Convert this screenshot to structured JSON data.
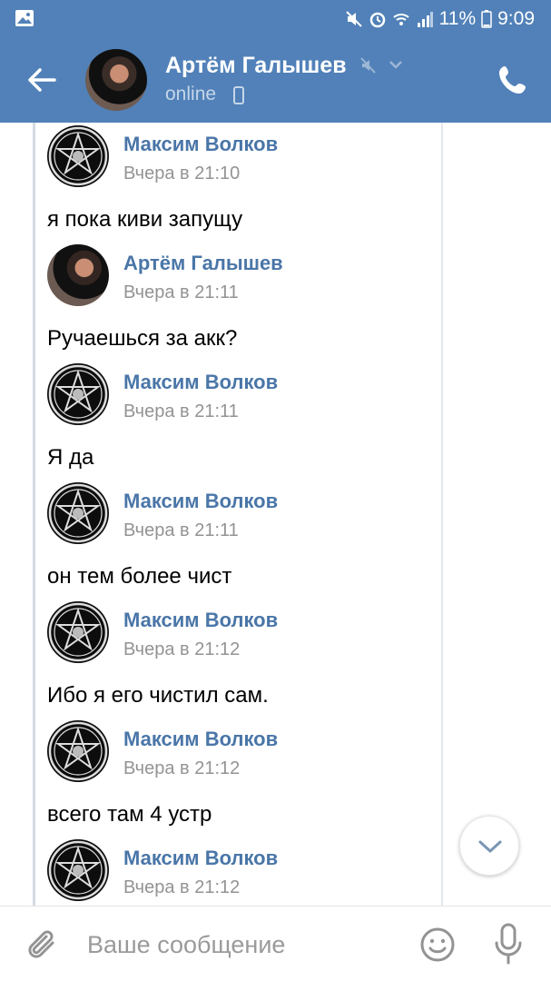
{
  "status_bar": {
    "battery": "11%",
    "time": "9:09",
    "icons": [
      "gallery-icon",
      "mute-icon",
      "alarm-icon",
      "wifi-icon",
      "signal-icon",
      "battery-icon"
    ]
  },
  "header": {
    "name": "Артём Галышев",
    "status": "online",
    "icons": [
      "back-arrow-icon",
      "muted-icon",
      "chevron-down-icon",
      "mobile-icon",
      "phone-icon"
    ]
  },
  "messages": [
    {
      "author": "Максим Волков",
      "time": "Вчера в 21:10",
      "text": "я пока киви запущу",
      "avatar": "pentagram"
    },
    {
      "author": "Артём Галышев",
      "time": "Вчера в 21:11",
      "text": "Ручаешься за акк?",
      "avatar": "photo"
    },
    {
      "author": "Максим Волков",
      "time": "Вчера в 21:11",
      "text": "Я да",
      "avatar": "pentagram"
    },
    {
      "author": "Максим Волков",
      "time": "Вчера в 21:11",
      "text": "он тем более чист",
      "avatar": "pentagram"
    },
    {
      "author": "Максим Волков",
      "time": "Вчера в 21:12",
      "text": "Ибо я его чистил сам.",
      "avatar": "pentagram"
    },
    {
      "author": "Максим Волков",
      "time": "Вчера в 21:12",
      "text": "всего там 4 устр",
      "avatar": "pentagram"
    },
    {
      "author": "Максим Волков",
      "time": "Вчера в 21:12",
      "text": "",
      "avatar": "pentagram"
    }
  ],
  "composer": {
    "placeholder": "Ваше сообщение",
    "value": ""
  },
  "colors": {
    "brand": "#5181b8",
    "author_link": "#4a76a8",
    "timestamp": "#939393"
  }
}
